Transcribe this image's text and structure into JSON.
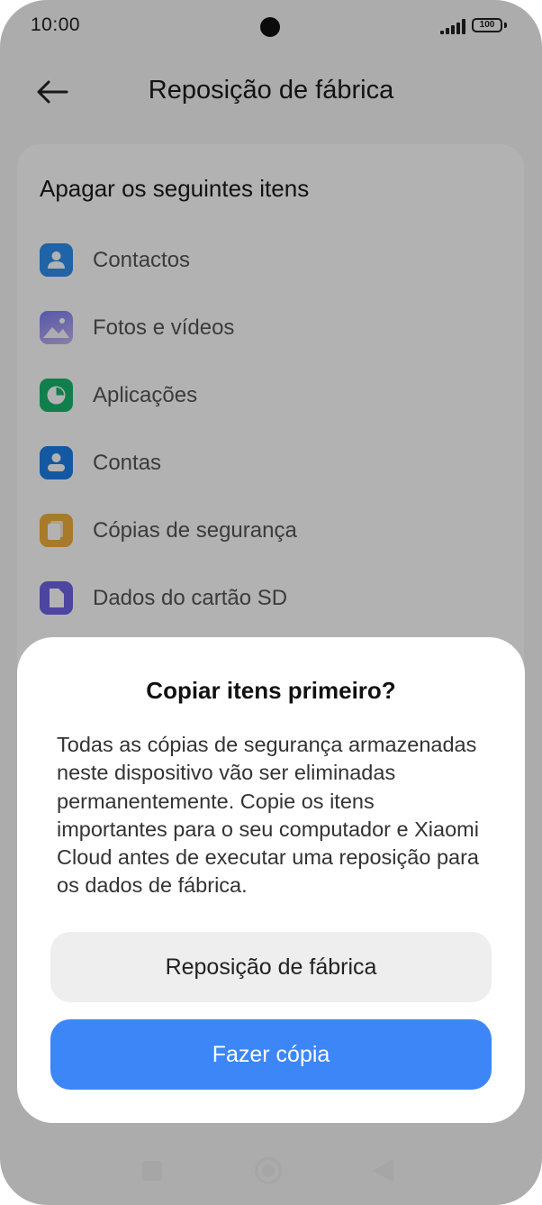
{
  "status_bar": {
    "time": "10:00",
    "battery": "100"
  },
  "header": {
    "back_icon": "arrow-left-icon",
    "title": "Reposição de fábrica"
  },
  "erase_section": {
    "title": "Apagar os seguintes itens",
    "items": [
      {
        "label": "Contactos",
        "icon": "contacts-icon",
        "color": "#2f8ef0"
      },
      {
        "label": "Fotos e vídeos",
        "icon": "gallery-icon",
        "color": "#8e8ef5"
      },
      {
        "label": "Aplicações",
        "icon": "apps-pie-icon",
        "color": "#18b66e"
      },
      {
        "label": "Contas",
        "icon": "account-icon",
        "color": "#1f7fe8"
      },
      {
        "label": "Cópias de segurança",
        "icon": "backup-icon",
        "color": "#f0b13c"
      },
      {
        "label": "Dados do cartão SD",
        "icon": "sd-card-icon",
        "color": "#6f63e6"
      }
    ]
  },
  "dialog": {
    "title": "Copiar itens primeiro?",
    "message": "Todas as cópias de segurança armazenadas neste dispositivo vão ser eliminadas permanentemente. Copie os itens importantes para o seu computador e Xiaomi Cloud antes de executar uma reposição para os dados de fábrica.",
    "reset_button": "Reposição de fábrica",
    "copy_button": "Fazer cópia",
    "accent_color": "#3c86f7"
  },
  "nav_bar": {
    "recents_icon": "square-icon",
    "home_icon": "home-circle-icon",
    "back_icon": "triangle-back-icon"
  }
}
